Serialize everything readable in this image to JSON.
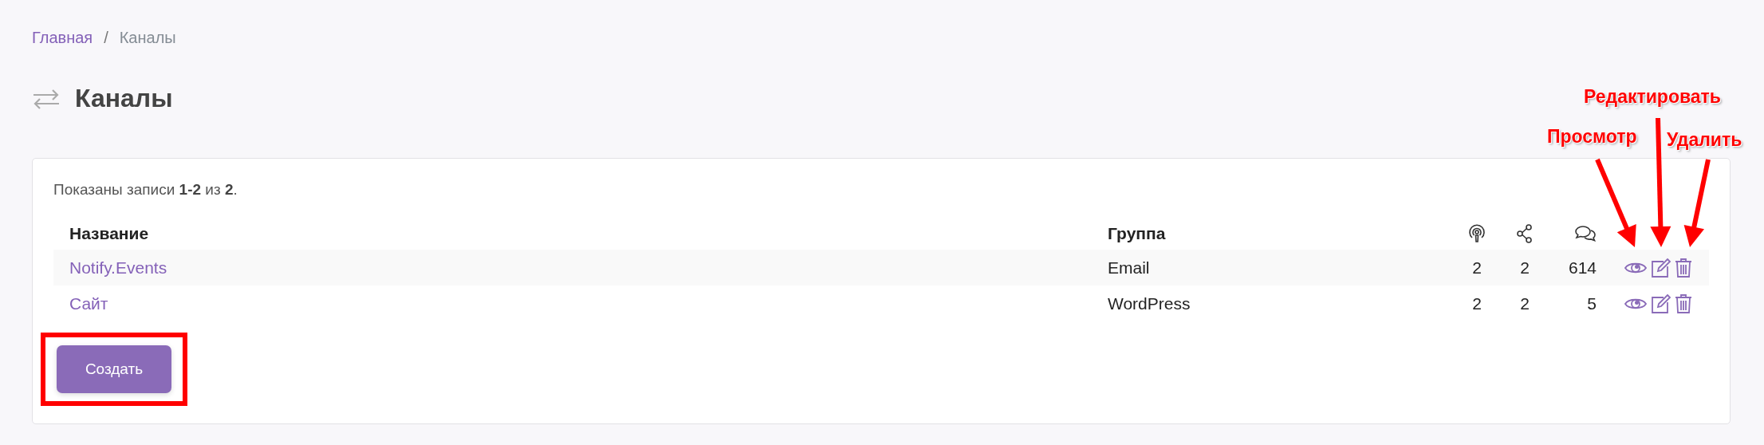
{
  "breadcrumb": {
    "separator": "/",
    "items": [
      {
        "label": "Главная",
        "link": true
      },
      {
        "label": "Каналы",
        "link": false
      }
    ]
  },
  "title": "Каналы",
  "summary": "Показаны записи **1-2** из **2**.",
  "table": {
    "columns": [
      {
        "label": "Название"
      },
      {
        "label": "Группа"
      }
    ],
    "rows": [
      {
        "name": "Notify.Events",
        "group": "Email",
        "col_3": "2",
        "col_4": "2",
        "col_5": "614"
      },
      {
        "name": "Сайт",
        "group": "WordPress",
        "col_3": "2",
        "col_4": "2",
        "col_5": "5"
      }
    ]
  },
  "create_button": {
    "label": "Создать",
    "highlighted": true
  },
  "annotations": [
    {
      "label": "Редактировать"
    },
    {
      "label": "Просмотр"
    },
    {
      "label": "Удалить"
    }
  ]
}
